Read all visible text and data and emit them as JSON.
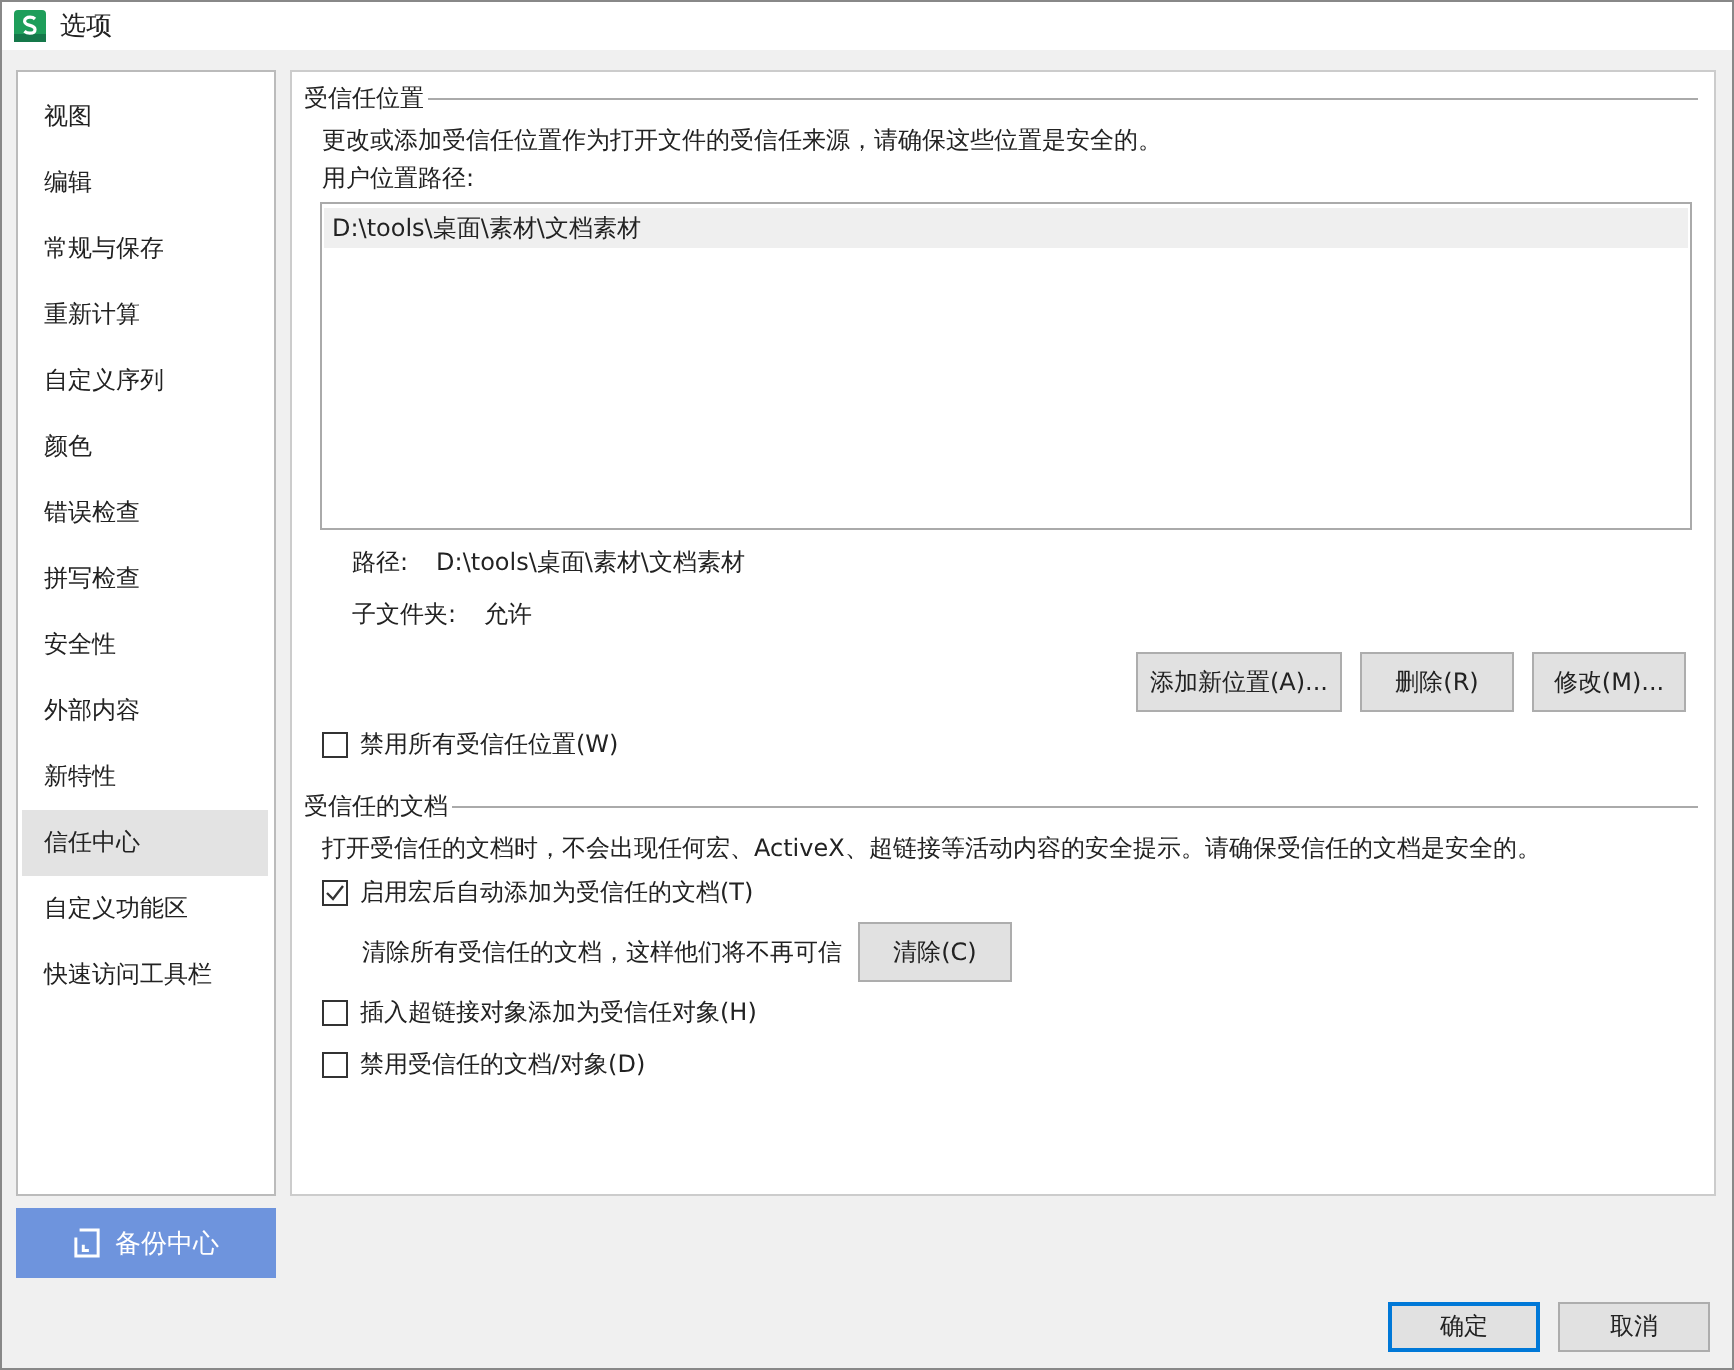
{
  "window": {
    "title": "选项"
  },
  "sidebar": {
    "items": [
      {
        "label": "视图",
        "selected": false
      },
      {
        "label": "编辑",
        "selected": false
      },
      {
        "label": "常规与保存",
        "selected": false
      },
      {
        "label": "重新计算",
        "selected": false
      },
      {
        "label": "自定义序列",
        "selected": false
      },
      {
        "label": "颜色",
        "selected": false
      },
      {
        "label": "错误检查",
        "selected": false
      },
      {
        "label": "拼写检查",
        "selected": false
      },
      {
        "label": "安全性",
        "selected": false
      },
      {
        "label": "外部内容",
        "selected": false
      },
      {
        "label": "新特性",
        "selected": false
      },
      {
        "label": "信任中心",
        "selected": true
      },
      {
        "label": "自定义功能区",
        "selected": false
      },
      {
        "label": "快速访问工具栏",
        "selected": false
      }
    ],
    "backup_button": "备份中心"
  },
  "trusted_locations": {
    "heading": "受信任位置",
    "description": "更改或添加受信任位置作为打开文件的受信任来源，请确保这些位置是安全的。",
    "list_label": "用户位置路径:",
    "paths": [
      {
        "text": "D:\\tools\\桌面\\素材\\文档素材",
        "selected": true
      }
    ],
    "details": [
      {
        "label": "路径:",
        "value": "D:\\tools\\桌面\\素材\\文档素材"
      },
      {
        "label": "子文件夹:",
        "value": "允许"
      }
    ],
    "buttons": [
      "添加新位置(A)...",
      "删除(R)",
      "修改(M)..."
    ],
    "disable_all": {
      "label": "禁用所有受信任位置(W)",
      "checked": false
    }
  },
  "trusted_documents": {
    "heading": "受信任的文档",
    "description": "打开受信任的文档时，不会出现任何宏、ActiveX、超链接等活动内容的安全提示。请确保受信任的文档是安全的。",
    "options": [
      {
        "kind": "checkbox",
        "label": "启用宏后自动添加为受信任的文档(T)",
        "checked": true
      },
      {
        "kind": "clear",
        "label": "清除所有受信任的文档，这样他们将不再可信",
        "button": "清除(C)"
      },
      {
        "kind": "checkbox",
        "label": "插入超链接对象添加为受信任对象(H)",
        "checked": false
      },
      {
        "kind": "checkbox",
        "label": "禁用受信任的文档/对象(D)",
        "checked": false
      }
    ]
  },
  "footer": {
    "buttons": [
      {
        "label": "确定",
        "default": true
      },
      {
        "label": "取消",
        "default": false
      }
    ]
  }
}
